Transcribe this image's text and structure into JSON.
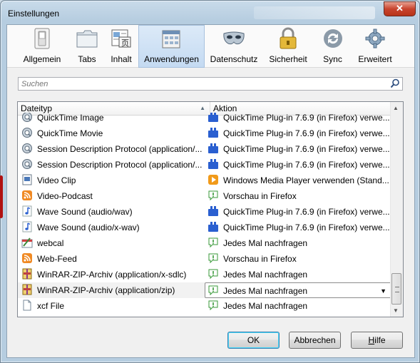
{
  "window": {
    "title": "Einstellungen",
    "close_glyph": "✕"
  },
  "toolbar": {
    "items": [
      {
        "label": "Allgemein",
        "icon": "switch-icon",
        "active": false
      },
      {
        "label": "Tabs",
        "icon": "folder-tabs-icon",
        "active": false
      },
      {
        "label": "Inhalt",
        "icon": "content-page-icon",
        "active": false
      },
      {
        "label": "Anwendungen",
        "icon": "applications-icon",
        "active": true
      },
      {
        "label": "Datenschutz",
        "icon": "mask-icon",
        "active": false
      },
      {
        "label": "Sicherheit",
        "icon": "padlock-icon",
        "active": false
      },
      {
        "label": "Sync",
        "icon": "sync-icon",
        "active": false
      },
      {
        "label": "Erweitert",
        "icon": "gear-icon",
        "active": false
      }
    ]
  },
  "search": {
    "placeholder": "Suchen"
  },
  "list": {
    "columns": {
      "type": "Dateityp",
      "action": "Aktion"
    },
    "rows": [
      {
        "type": "QuickTime Image",
        "type_icon": "quicktime-icon",
        "action": "QuickTime Plug-in 7.6.9 (in Firefox) verwe...",
        "action_icon": "plugin-icon"
      },
      {
        "type": "QuickTime Movie",
        "type_icon": "quicktime-icon",
        "action": "QuickTime Plug-in 7.6.9 (in Firefox) verwe...",
        "action_icon": "plugin-icon"
      },
      {
        "type": "Session Description Protocol (application/...",
        "type_icon": "quicktime-icon",
        "action": "QuickTime Plug-in 7.6.9 (in Firefox) verwe...",
        "action_icon": "plugin-icon"
      },
      {
        "type": "Session Description Protocol (application/...",
        "type_icon": "quicktime-icon",
        "action": "QuickTime Plug-in 7.6.9 (in Firefox) verwe...",
        "action_icon": "plugin-icon"
      },
      {
        "type": "Video Clip",
        "type_icon": "video-clip-icon",
        "action": "Windows Media Player verwenden (Stand...",
        "action_icon": "media-player-icon"
      },
      {
        "type": "Video-Podcast",
        "type_icon": "rss-feed-icon",
        "action": "Vorschau in Firefox",
        "action_icon": "preview-icon"
      },
      {
        "type": "Wave Sound (audio/wav)",
        "type_icon": "music-note-icon",
        "action": "QuickTime Plug-in 7.6.9 (in Firefox) verwe...",
        "action_icon": "plugin-icon"
      },
      {
        "type": "Wave Sound (audio/x-wav)",
        "type_icon": "music-note-icon",
        "action": "QuickTime Plug-in 7.6.9 (in Firefox) verwe...",
        "action_icon": "plugin-icon"
      },
      {
        "type": "webcal",
        "type_icon": "webcal-icon",
        "action": "Jedes Mal nachfragen",
        "action_icon": "ask-icon"
      },
      {
        "type": "Web-Feed",
        "type_icon": "rss-feed-icon",
        "action": "Vorschau in Firefox",
        "action_icon": "preview-icon"
      },
      {
        "type": "WinRAR-ZIP-Archiv (application/x-sdlc)",
        "type_icon": "winrar-icon",
        "action": "Jedes Mal nachfragen",
        "action_icon": "ask-icon"
      },
      {
        "type": "WinRAR-ZIP-Archiv (application/zip)",
        "type_icon": "winrar-icon",
        "action": "Jedes Mal nachfragen",
        "action_icon": "ask-icon",
        "selected": true
      },
      {
        "type": "xcf File",
        "type_icon": "file-icon",
        "action": "Jedes Mal nachfragen",
        "action_icon": "ask-icon"
      }
    ]
  },
  "buttons": {
    "ok": "OK",
    "cancel": "Abbrechen",
    "help_mnemonic": "H",
    "help_rest": "ilfe"
  },
  "colors": {
    "selected_toolbar": "#c4daf2",
    "plugin_blue": "#2a5fd0",
    "rss_orange": "#f08a24"
  }
}
